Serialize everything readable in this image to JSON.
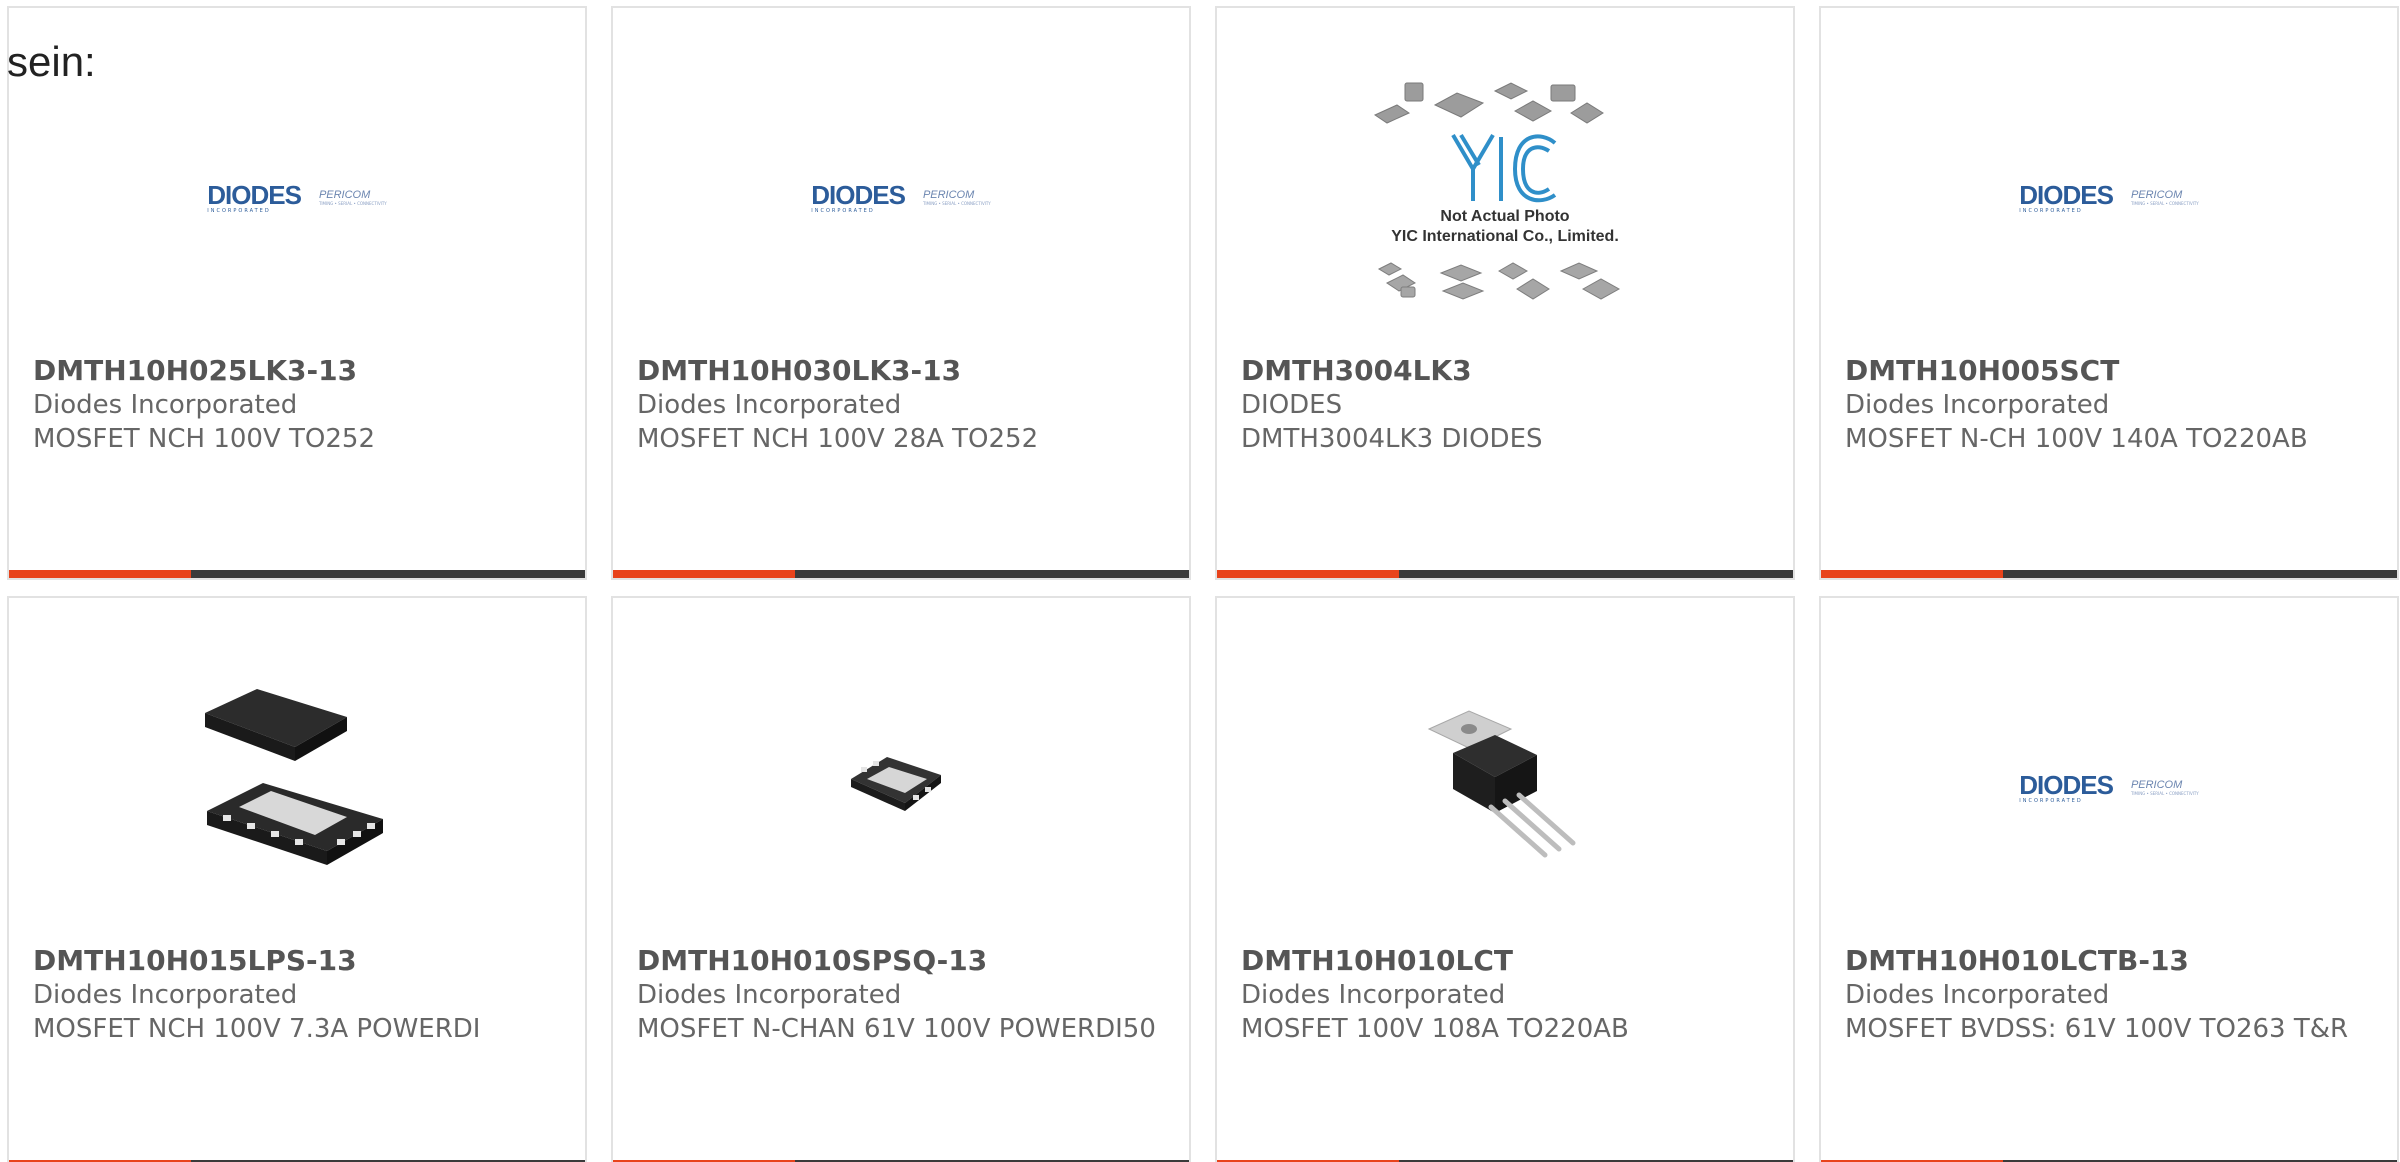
{
  "lead_text": "sein:",
  "colors": {
    "accent": "#e8431b",
    "bar": "#3a3a3a",
    "border": "#e2e2e2"
  },
  "brand": {
    "diodes": "DIODES",
    "diodes_sub": "INCORPORATED",
    "pericom": "PERICOM",
    "pericom_sub": "TIMING • SERIAL • CONNECTIVITY"
  },
  "yic": {
    "logo": "YIC",
    "line1": "Not Actual Photo",
    "line2": "YIC International Co., Limited."
  },
  "products": [
    {
      "part": "DMTH10H025LK3-13",
      "manufacturer": "Diodes Incorporated",
      "description": "MOSFET NCH 100V TO252",
      "image": "diodes-logo"
    },
    {
      "part": "DMTH10H030LK3-13",
      "manufacturer": "Diodes Incorporated",
      "description": "MOSFET NCH 100V 28A TO252",
      "image": "diodes-logo"
    },
    {
      "part": "DMTH3004LK3",
      "manufacturer": "DIODES",
      "description": "DMTH3004LK3 DIODES",
      "image": "yic-placeholder"
    },
    {
      "part": "DMTH10H005SCT",
      "manufacturer": "Diodes Incorporated",
      "description": "MOSFET N-CH 100V 140A TO220AB",
      "image": "diodes-logo"
    },
    {
      "part": "DMTH10H015LPS-13",
      "manufacturer": "Diodes Incorporated",
      "description": "MOSFET NCH 100V 7.3A POWERDI",
      "image": "powerdi-package"
    },
    {
      "part": "DMTH10H010SPSQ-13",
      "manufacturer": "Diodes Incorporated",
      "description": "MOSFET N-CHAN 61V 100V POWERDI50",
      "image": "powerdi-small-package"
    },
    {
      "part": "DMTH10H010LCT",
      "manufacturer": "Diodes Incorporated",
      "description": "MOSFET 100V 108A TO220AB",
      "image": "to220-package"
    },
    {
      "part": "DMTH10H010LCTB-13",
      "manufacturer": "Diodes Incorporated",
      "description": "MOSFET BVDSS: 61V 100V TO263 T&R",
      "image": "diodes-logo"
    }
  ]
}
